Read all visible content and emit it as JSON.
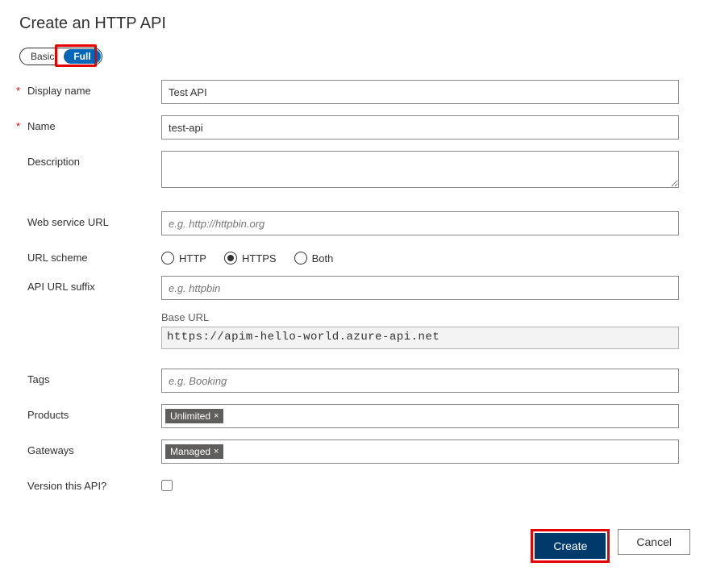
{
  "title": "Create an HTTP API",
  "tabs": {
    "basic": "Basic",
    "full": "Full"
  },
  "fields": {
    "displayName": {
      "label": "Display name",
      "value": "Test API",
      "required": true
    },
    "name": {
      "label": "Name",
      "value": "test-api",
      "required": true
    },
    "description": {
      "label": "Description",
      "value": ""
    },
    "webServiceUrl": {
      "label": "Web service URL",
      "placeholder": "e.g. http://httpbin.org",
      "value": ""
    },
    "urlScheme": {
      "label": "URL scheme",
      "options": {
        "http": "HTTP",
        "https": "HTTPS",
        "both": "Both"
      },
      "selected": "https"
    },
    "apiUrlSuffix": {
      "label": "API URL suffix",
      "placeholder": "e.g. httpbin",
      "value": ""
    },
    "baseUrl": {
      "label": "Base URL",
      "value": "https://apim-hello-world.azure-api.net"
    },
    "tags": {
      "label": "Tags",
      "placeholder": "e.g. Booking",
      "value": ""
    },
    "products": {
      "label": "Products",
      "chips": [
        "Unlimited"
      ]
    },
    "gateways": {
      "label": "Gateways",
      "chips": [
        "Managed"
      ]
    },
    "version": {
      "label": "Version this API?",
      "checked": false
    }
  },
  "buttons": {
    "create": "Create",
    "cancel": "Cancel"
  },
  "chipClose": "×"
}
